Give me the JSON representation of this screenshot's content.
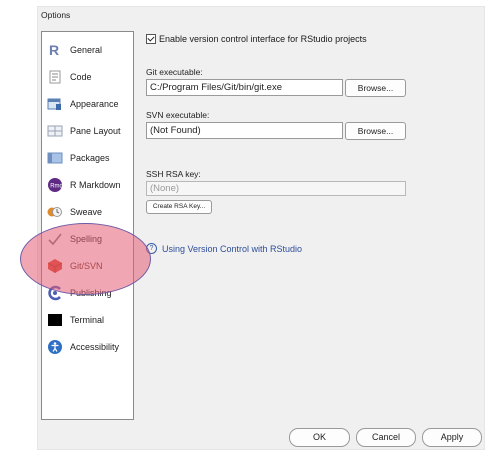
{
  "window": {
    "title": "Options"
  },
  "sidebar": {
    "items": [
      {
        "label": "General",
        "icon": "r-logo-icon"
      },
      {
        "label": "Code",
        "icon": "code-icon"
      },
      {
        "label": "Appearance",
        "icon": "appearance-icon"
      },
      {
        "label": "Pane Layout",
        "icon": "pane-layout-icon"
      },
      {
        "label": "Packages",
        "icon": "packages-icon"
      },
      {
        "label": "R Markdown",
        "icon": "r-markdown-icon"
      },
      {
        "label": "Sweave",
        "icon": "sweave-icon"
      },
      {
        "label": "Spelling",
        "icon": "spelling-icon"
      },
      {
        "label": "Git/SVN",
        "icon": "git-svn-icon",
        "selected": true
      },
      {
        "label": "Publishing",
        "icon": "publishing-icon"
      },
      {
        "label": "Terminal",
        "icon": "terminal-icon"
      },
      {
        "label": "Accessibility",
        "icon": "accessibility-icon"
      }
    ]
  },
  "git_svn": {
    "enable_vcs": {
      "label": "Enable version control interface for RStudio projects",
      "checked": true
    },
    "git_label": "Git executable:",
    "git_value": "C:/Program Files/Git/bin/git.exe",
    "svn_label": "SVN executable:",
    "svn_value": "(Not Found)",
    "browse_label": "Browse...",
    "ssh_label": "SSH RSA key:",
    "ssh_value": "(None)",
    "create_key_label": "Create RSA Key...",
    "help_link": "Using Version Control with RStudio"
  },
  "footer": {
    "ok": "OK",
    "cancel": "Cancel",
    "apply": "Apply"
  },
  "colors": {
    "highlight": "#e55c74",
    "highlight_border": "#6e5aa4",
    "link": "#2d4d9a",
    "selected_icon": "#d9452a"
  }
}
